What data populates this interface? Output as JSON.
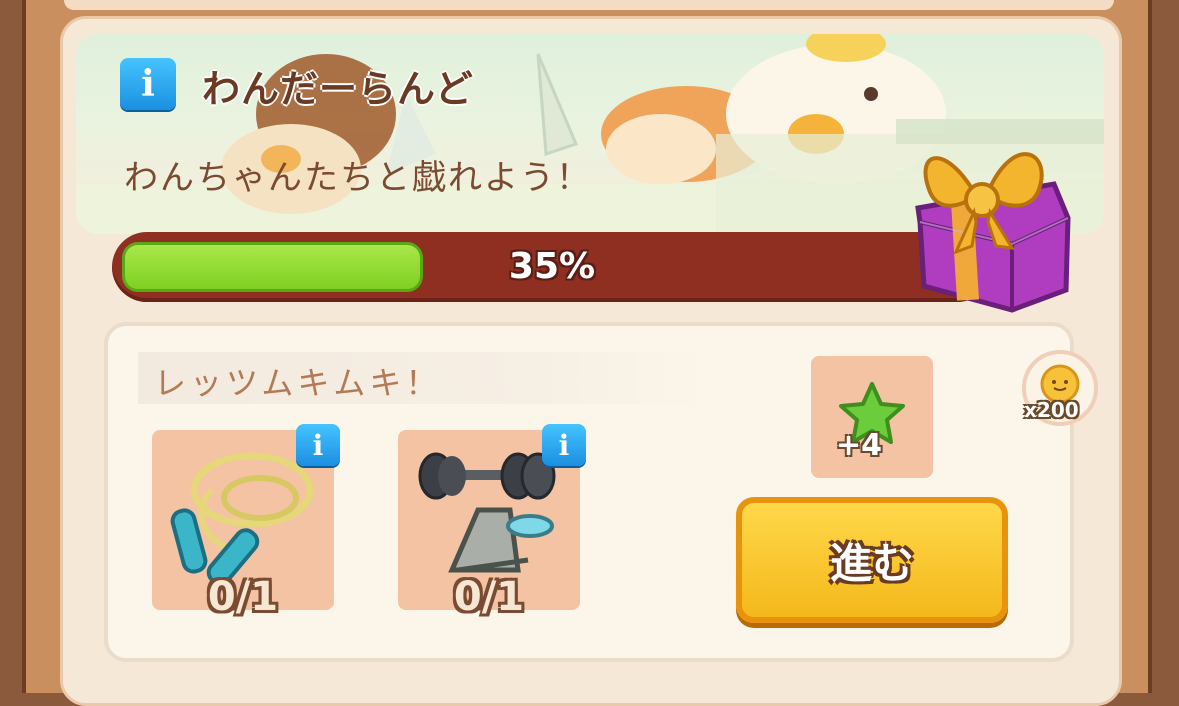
{
  "event": {
    "title": "わんだーらんど",
    "subtitle": "わんちゃんたちと戯れよう！",
    "info_icon": "info-icon"
  },
  "progress": {
    "percent": 35,
    "label": "35%",
    "fill_color": "#8fdc33",
    "track_color": "#8e2f22",
    "reward_icon": "gift-box-icon"
  },
  "mission": {
    "title": "レッツムキムキ！",
    "items": [
      {
        "icon": "jump-rope-icon",
        "count": "0/1",
        "info_icon": "info-icon"
      },
      {
        "icon": "dumbbell-bench-icon",
        "count": "0/1",
        "info_icon": "info-icon"
      }
    ],
    "reward": {
      "icon": "green-star-icon",
      "count": "+4"
    },
    "coin_reward": {
      "icon": "sun-coin-icon",
      "count": "x200"
    },
    "go_button_label": "進む"
  },
  "colors": {
    "accent_button": "#f4b81b",
    "info_blue": "#1b8fe0",
    "text_brown": "#6a3a22"
  }
}
